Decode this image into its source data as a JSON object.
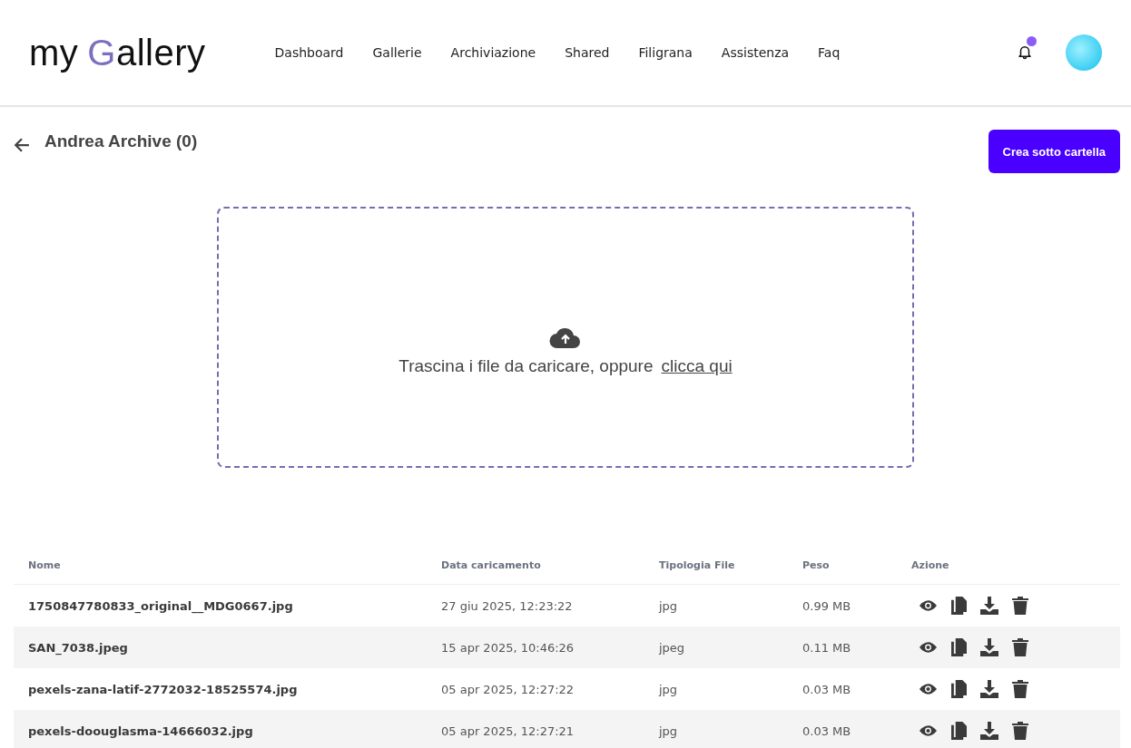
{
  "header": {
    "logo": {
      "prefix": "my",
      "initial": "G",
      "rest": "allery"
    },
    "nav": [
      {
        "label": "Dashboard"
      },
      {
        "label": "Gallerie"
      },
      {
        "label": "Archiviazione"
      },
      {
        "label": "Shared"
      },
      {
        "label": "Filigrana"
      },
      {
        "label": "Assistenza"
      },
      {
        "label": "Faq"
      }
    ],
    "has_notification": true
  },
  "page": {
    "title": "Andrea Archive (0)",
    "action_button": "Crea sotto cartella"
  },
  "dropzone": {
    "text": "Trascina i file da caricare, oppure",
    "link": "clicca qui"
  },
  "table": {
    "columns": [
      "Nome",
      "Data caricamento",
      "Tipologia File",
      "Peso",
      "Azione"
    ],
    "rows": [
      {
        "name": "1750847780833_original__MDG0667.jpg",
        "date": "27 giu 2025, 12:23:22",
        "type": "jpg",
        "size": "0.99 MB"
      },
      {
        "name": "SAN_7038.jpeg",
        "date": "15 apr 2025, 10:46:26",
        "type": "jpeg",
        "size": "0.11 MB"
      },
      {
        "name": "pexels-zana-latif-2772032-18525574.jpg",
        "date": "05 apr 2025, 12:27:22",
        "type": "jpg",
        "size": "0.03 MB"
      },
      {
        "name": "pexels-doouglasma-14666032.jpg",
        "date": "05 apr 2025, 12:27:21",
        "type": "jpg",
        "size": "0.03 MB"
      }
    ]
  }
}
